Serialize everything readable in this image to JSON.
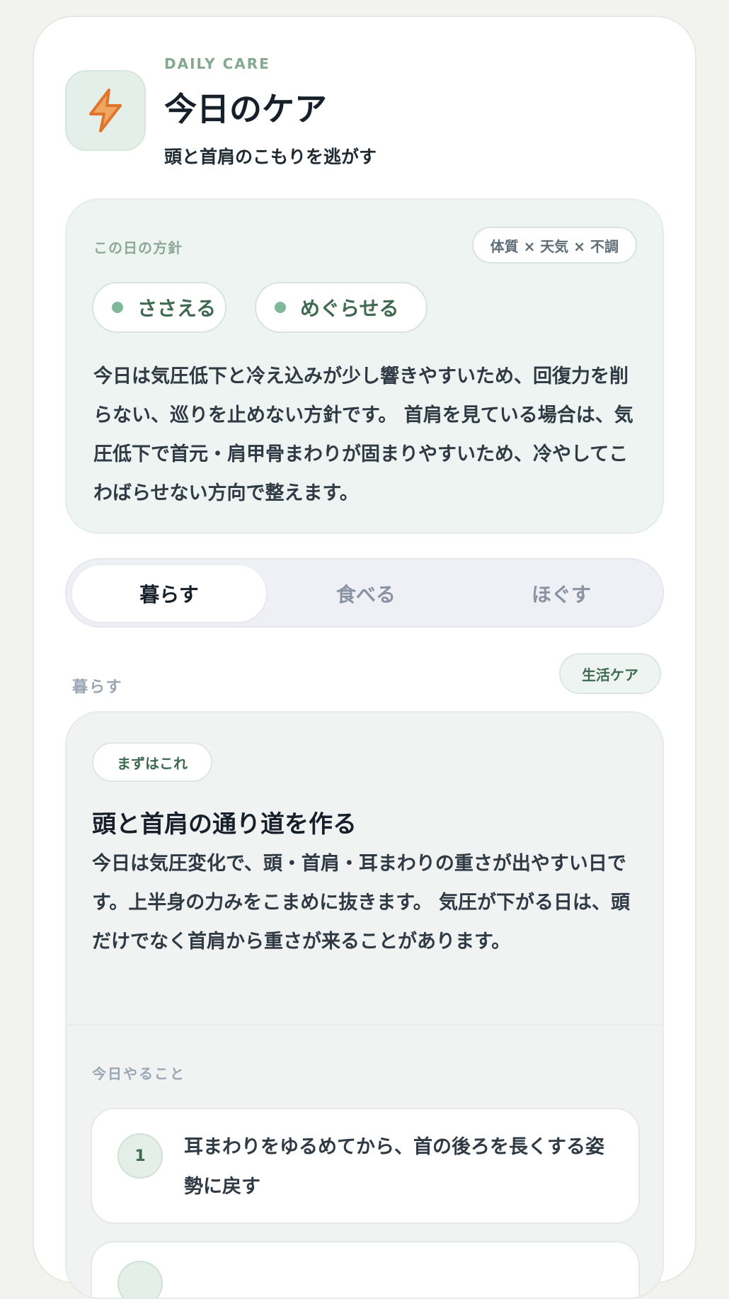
{
  "header": {
    "icon": "lightning-icon",
    "eyebrow": "DAILY CARE",
    "title": "今日のケア",
    "subtitle": "頭と首肩のこもりを逃がす"
  },
  "policy": {
    "label": "この日の方針",
    "factor_badge": "体質 × 天気 × 不調",
    "chips": [
      "ささえる",
      "めぐらせる"
    ],
    "text": "今日は気圧低下と冷え込みが少し響きやすいため、回復力を削らない、巡りを止めない方針です。 首肩を見ている場合は、気圧低下で首元・肩甲骨まわりが固まりやすいため、冷やしてこわばらせない方向で整えます。"
  },
  "tabs": [
    {
      "label": "暮らす",
      "active": true
    },
    {
      "label": "食べる",
      "active": false
    },
    {
      "label": "ほぐす",
      "active": false
    }
  ],
  "section": {
    "label": "暮らす",
    "tag": "生活ケア"
  },
  "action": {
    "badge": "まずはこれ",
    "title": "頭と首肩の通り道を作る",
    "text": "今日は気圧変化で、頭・首肩・耳まわりの重さが出やすい日です。上半身の力みをこまめに抜きます。 気圧が下がる日は、頭だけでなく首肩から重さが来ることがあります。",
    "todo_label": "今日やること",
    "steps": [
      {
        "number": "1",
        "text": "耳まわりをゆるめてから、首の後ろを長くする姿勢に戻す"
      }
    ]
  },
  "colors": {
    "accent_green": "#3f6a51",
    "icon_orange": "#e98a3a",
    "panel_bg": "#eef4f1"
  }
}
